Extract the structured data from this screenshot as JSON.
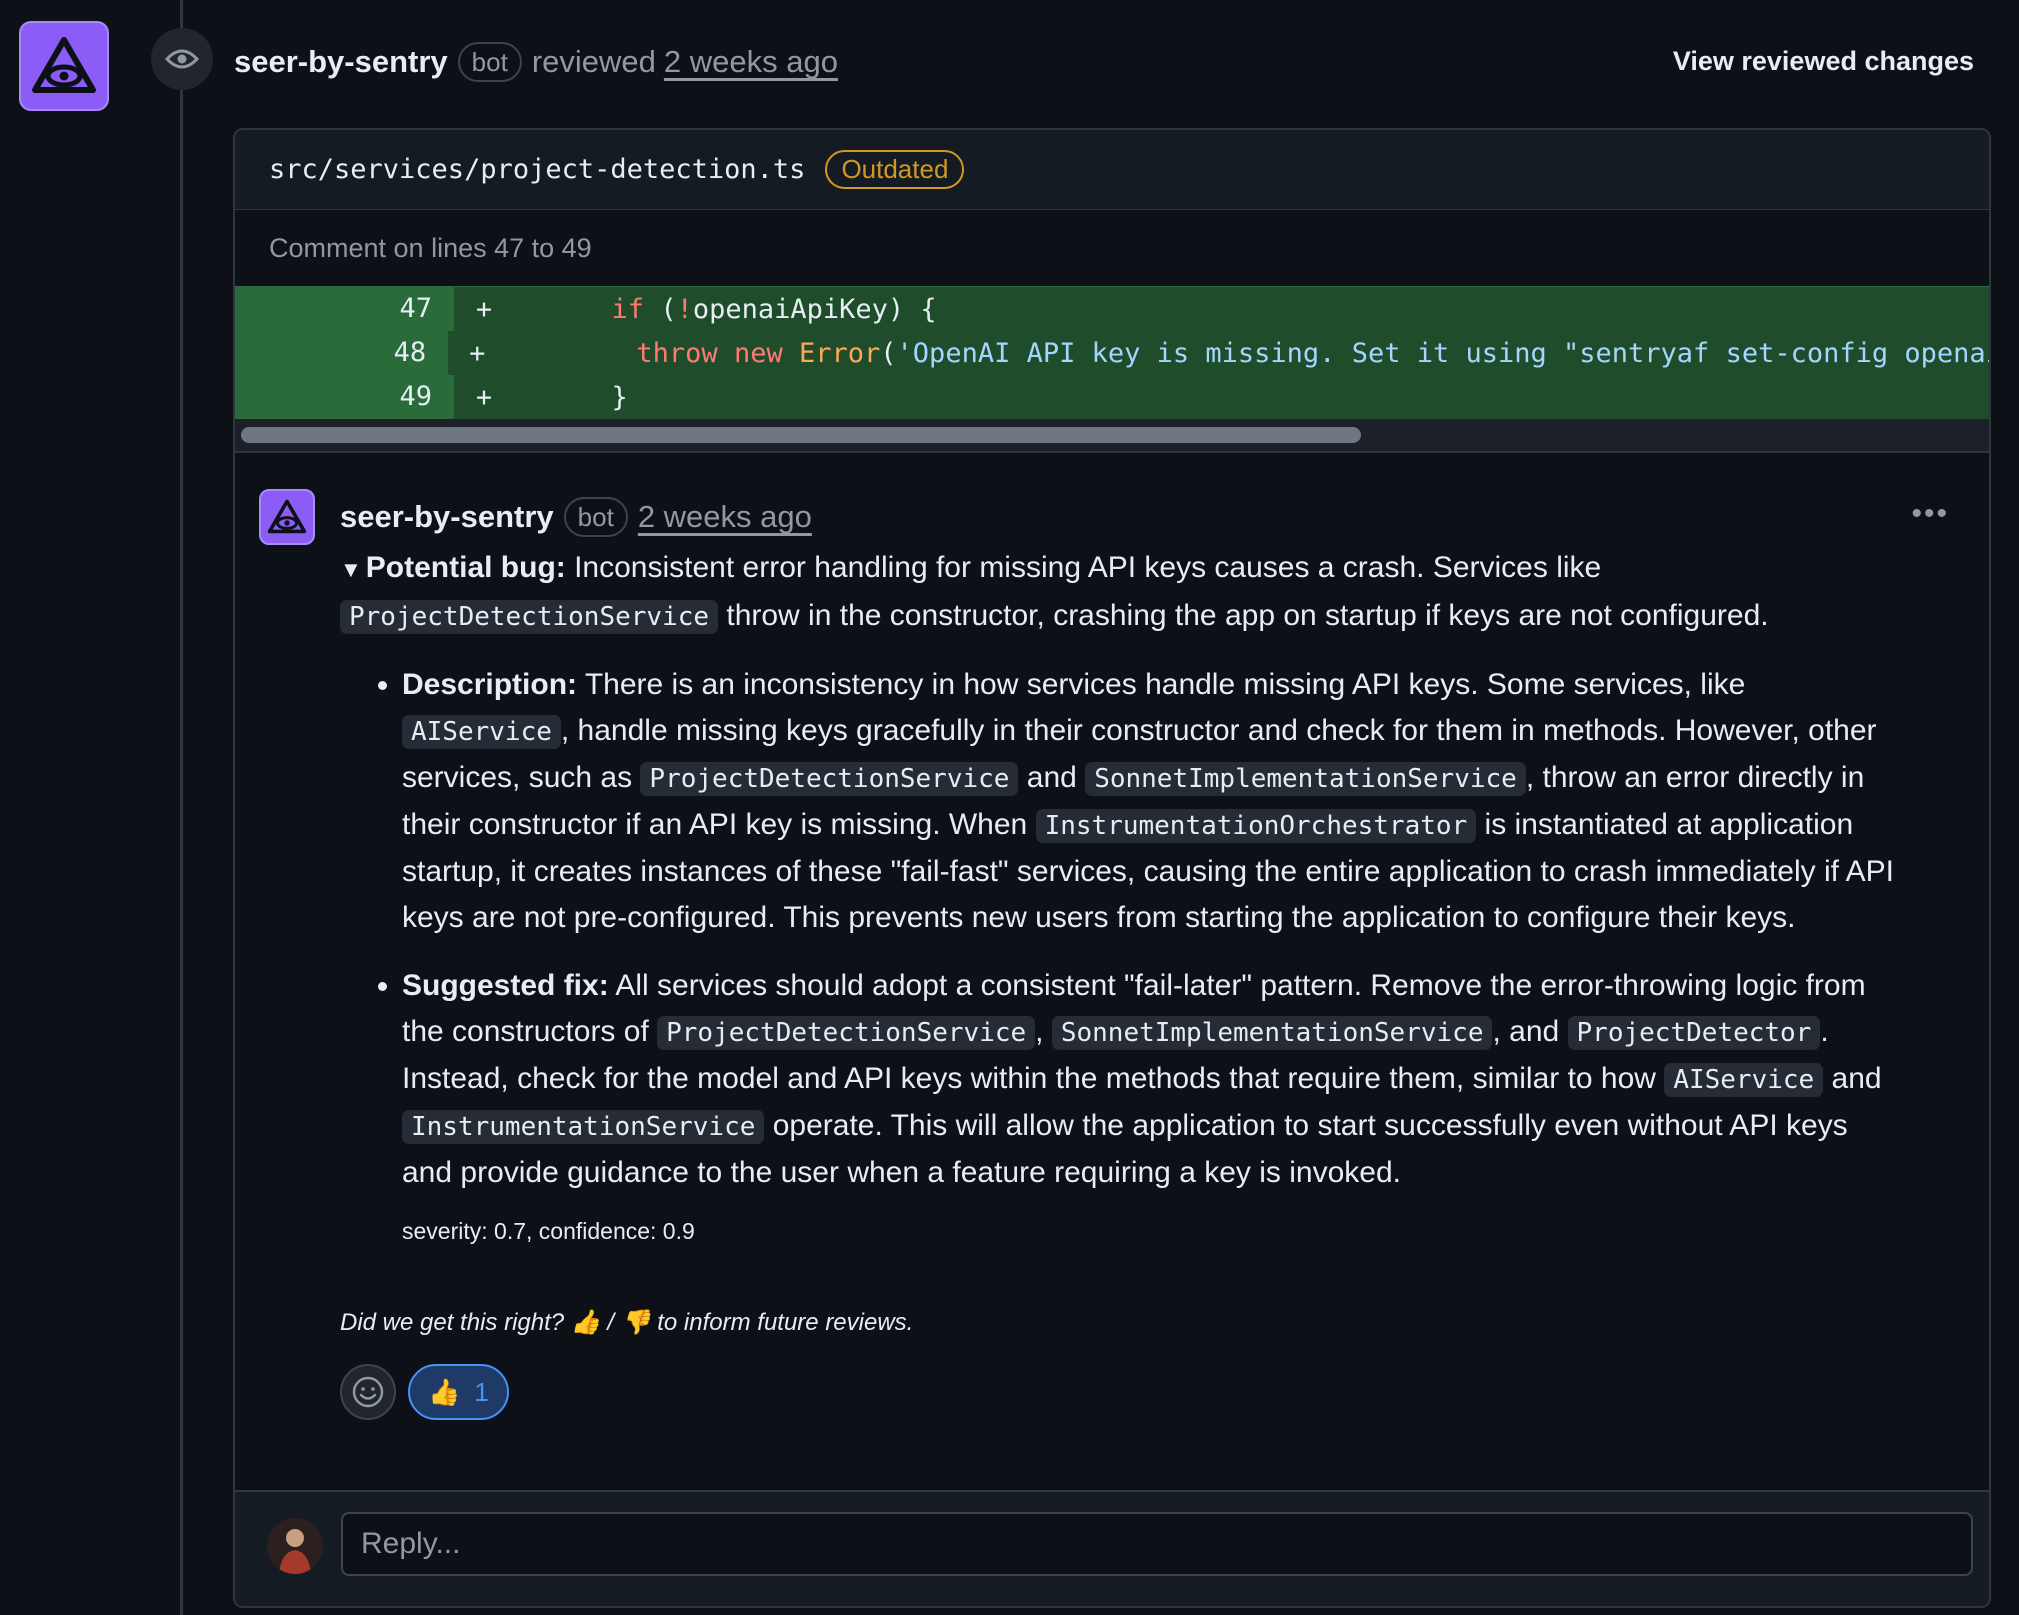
{
  "review": {
    "author": "seer-by-sentry",
    "bot_badge": "bot",
    "action": "reviewed",
    "time": "2 weeks ago",
    "view_changes": "View reviewed changes"
  },
  "file": {
    "path": "src/services/project-detection.ts",
    "status_badge": "Outdated",
    "comment_lines": "Comment on lines 47 to 49"
  },
  "diff": {
    "lines": [
      {
        "num": "47",
        "marker": "+"
      },
      {
        "num": "48",
        "marker": "+"
      },
      {
        "num": "49",
        "marker": "+"
      }
    ],
    "code": {
      "l47_kw": "if",
      "l47_rest": " (",
      "l47_bang": "!",
      "l47_tail": "openaiApiKey) {",
      "l48_throw": "throw",
      "l48_new": "new",
      "l48_error": "Error",
      "l48_paren": "(",
      "l48_str": "'OpenAI API key is missing. Set it using \"sentryaf set-config openai-k",
      "l49": "}"
    }
  },
  "comment": {
    "author": "seer-by-sentry",
    "bot_badge": "bot",
    "time": "2 weeks ago",
    "more": "•••",
    "summary_label": "Potential bug:",
    "summary_text_1": " Inconsistent error handling for missing API keys causes a crash. Services like",
    "summary_code": "ProjectDetectionService",
    "summary_text_2": " throw in the constructor, crashing the app on startup if keys are not configured.",
    "desc_label": "Description:",
    "desc_1": " There is an inconsistency in how services handle missing API keys. Some services, like ",
    "desc_code_1": "AIService",
    "desc_2": ", handle missing keys gracefully in their constructor and check for them in methods. However, other services, such as ",
    "desc_code_2": "ProjectDetectionService",
    "desc_3": " and ",
    "desc_code_3": "SonnetImplementationService",
    "desc_4": ", throw an error directly in their constructor if an API key is missing. When ",
    "desc_code_4": "InstrumentationOrchestrator",
    "desc_5": " is instantiated at application startup, it creates instances of these \"fail-fast\" services, causing the entire application to crash immediately if API keys are not pre-configured. This prevents new users from starting the application to configure their keys.",
    "fix_label": "Suggested fix:",
    "fix_1": " All services should adopt a consistent \"fail-later\" pattern. Remove the error-throwing logic from the constructors of ",
    "fix_code_1": "ProjectDetectionService",
    "fix_2": ", ",
    "fix_code_2": "SonnetImplementationService",
    "fix_3": ", and ",
    "fix_code_3": "ProjectDetector",
    "fix_4": ". Instead, check for the model and API keys within the methods that require them, similar to how ",
    "fix_code_4": "AIService",
    "fix_5": " and ",
    "fix_code_5": "InstrumentationService",
    "fix_6": " operate. This will allow the application to start successfully even without API keys and provide guidance to the user when a feature requiring a key is invoked.",
    "severity": "severity: 0.7, confidence: 0.9",
    "feedback_1": "Did we get this right? ",
    "feedback_thumb_up": "👍",
    "feedback_sep": " / ",
    "feedback_thumb_down": "👎",
    "feedback_2": " to inform future reviews.",
    "reaction_emoji": "👍",
    "reaction_count": "1"
  },
  "reply": {
    "placeholder": "Reply..."
  },
  "colors": {
    "bot_avatar": "#8b5cf6",
    "outdated": "#d29922",
    "diff_added": "#1f4d2c",
    "reaction_accent": "#4493f8"
  }
}
